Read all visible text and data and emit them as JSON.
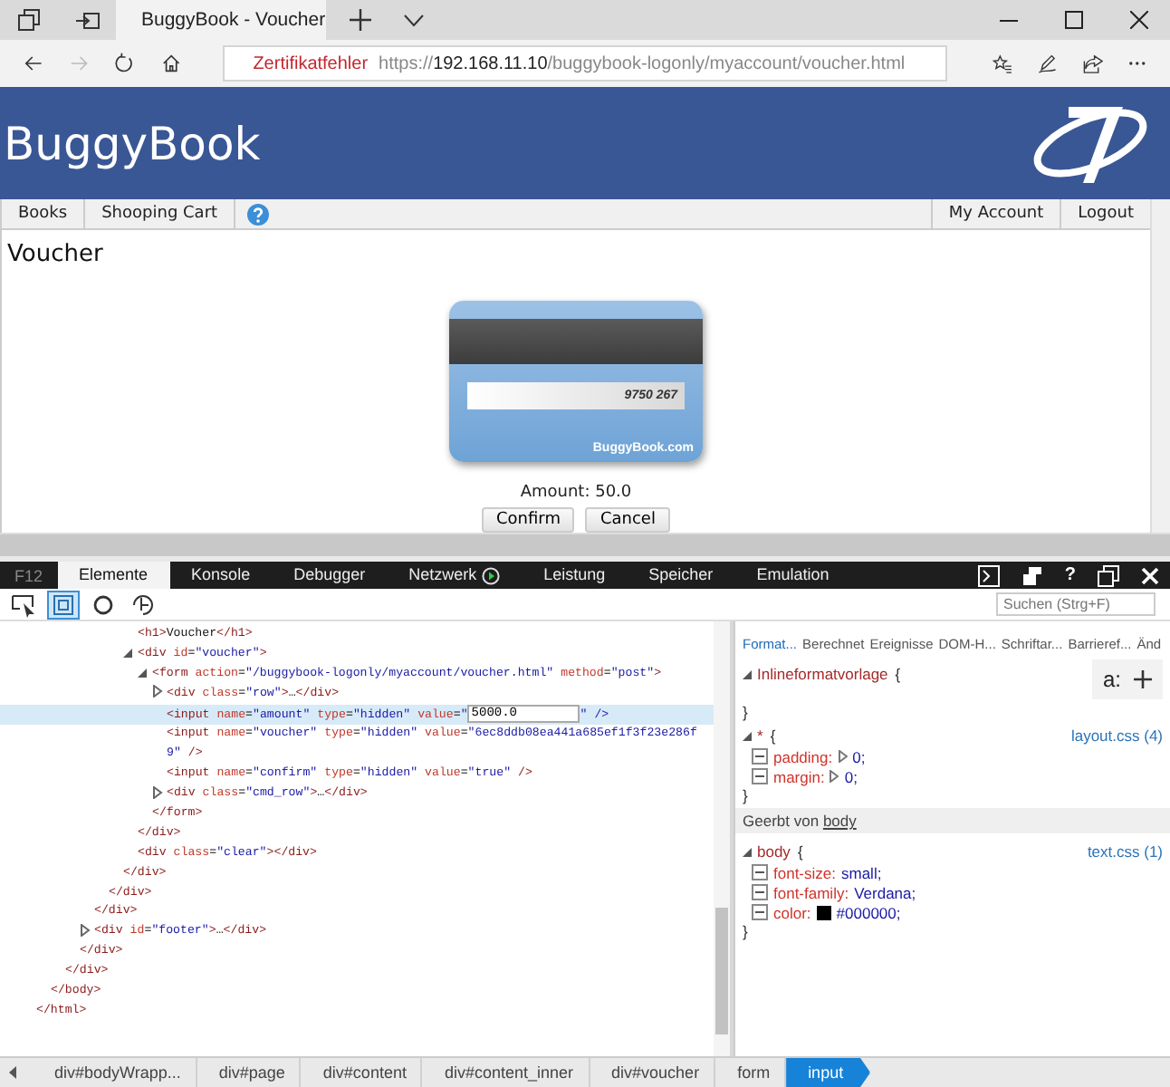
{
  "browser": {
    "tabs": [
      {
        "title": "BuggyBook - Voucher",
        "selected": true
      }
    ],
    "nav_buttons": [
      {
        "kind": "back",
        "disabled": false
      },
      {
        "kind": "forward",
        "disabled": true
      },
      {
        "kind": "refresh",
        "disabled": false
      },
      {
        "kind": "home",
        "disabled": false
      }
    ],
    "address": {
      "warning": "Zertifikatfehler",
      "scheme": "https://",
      "host": "192.168.11.10",
      "path": "/buggybook-logonly/myaccount/voucher.html"
    }
  },
  "site": {
    "title": "BuggyBook",
    "nav_left": [
      {
        "label": "Books"
      },
      {
        "label": "Shooping Cart"
      }
    ],
    "nav_right": [
      {
        "label": "My Account"
      },
      {
        "label": "Logout"
      }
    ],
    "heading": "Voucher",
    "card": {
      "strip_number": "9750 267",
      "brand": "BuggyBook.com"
    },
    "amount_label": "Amount:",
    "amount": "50.0",
    "buttons": [
      "Confirm",
      "Cancel"
    ]
  },
  "devtools": {
    "f12": "F12",
    "tabs": [
      {
        "label": "Elemente",
        "selected": true,
        "recording": false
      },
      {
        "label": "Konsole",
        "selected": false,
        "recording": false
      },
      {
        "label": "Debugger",
        "selected": false,
        "recording": false
      },
      {
        "label": "Netzwerk",
        "selected": false,
        "recording": true
      },
      {
        "label": "Leistung",
        "selected": false,
        "recording": false
      },
      {
        "label": "Speicher",
        "selected": false,
        "recording": false
      },
      {
        "label": "Emulation",
        "selected": false,
        "recording": false
      }
    ],
    "help": "?",
    "tools": [
      {
        "kind": "select",
        "selected": false
      },
      {
        "kind": "highlight",
        "selected": true
      },
      {
        "kind": "color",
        "selected": false
      },
      {
        "kind": "touch",
        "selected": false
      }
    ],
    "search": {
      "placeholder": "Suchen (Strg+F)"
    },
    "dom": [
      {
        "close": "</html>",
        "children": [
          {
            "close": "</body>",
            "children": [
              {
                "close": "</div>",
                "children": [
                  {
                    "close": "</div>",
                    "children": [
                      {
                        "close": "</div>",
                        "children": [
                          {
                            "close": "</div>",
                            "children": [
                              {
                                "close": "</div>",
                                "children": [
                                  {
                                    "line": "<h1>Voucher</h1>",
                                    "selected": false
                                  },
                                  {
                                    "line": "<div id=\"voucher\">",
                                    "selected": false,
                                    "expanded": true,
                                    "close": "</div>",
                                    "children": [
                                      {
                                        "line": "<form action=\"/buggybook-logonly/myaccount/voucher.html\" method=\"post\">",
                                        "selected": false,
                                        "expanded": true,
                                        "close": "</form>",
                                        "children": [
                                          {
                                            "line": "<div class=\"row\">…</div>",
                                            "selected": false,
                                            "expanded": false
                                          },
                                          {
                                            "line": "<input name=\"amount\" type=\"hidden\" value=\"",
                                            "edit": "5000.0",
                                            "line_end": "\" />",
                                            "selected": true
                                          },
                                          {
                                            "line": "<input name=\"voucher\" type=\"hidden\" value=\"6ec8ddb08ea441a685ef1f3f23e286f9\" />",
                                            "selected": false
                                          },
                                          {
                                            "line": "<input name=\"confirm\" type=\"hidden\" value=\"true\" />",
                                            "selected": false
                                          },
                                          {
                                            "line": "<div class=\"cmd_row\">…</div>",
                                            "selected": false,
                                            "expanded": false
                                          }
                                        ]
                                      }
                                    ]
                                  },
                                  {
                                    "line": "<div class=\"clear\"></div>",
                                    "selected": false
                                  }
                                ]
                              }
                            ]
                          }
                        ]
                      },
                      {
                        "line": "<div id=\"footer\">…</div>",
                        "selected": false,
                        "expanded": false
                      }
                    ]
                  }
                ]
              }
            ]
          }
        ]
      }
    ],
    "styles": {
      "tabs": [
        {
          "label": "Format...",
          "selected": true
        },
        {
          "label": "Berechnet",
          "selected": false
        },
        {
          "label": "Ereignisse",
          "selected": false
        },
        {
          "label": "DOM-H...",
          "selected": false
        },
        {
          "label": "Schriftar...",
          "selected": false
        },
        {
          "label": "Barrieref...",
          "selected": false
        },
        {
          "label": "Änd",
          "selected": false
        }
      ],
      "rules": [
        {
          "kind": "rule",
          "selector": "Inlineformatvorlage",
          "open": "{",
          "close": "}",
          "expanded": true,
          "action": "a:"
        },
        {
          "kind": "rule",
          "selector": "*",
          "open": "{",
          "close": "}",
          "expanded": true,
          "source": "layout.css (4)",
          "properties": [
            {
              "name": "padding:",
              "value": "0;",
              "checked": true,
              "expandable": true
            },
            {
              "name": "margin:",
              "value": "0;",
              "checked": true,
              "expandable": true
            }
          ]
        },
        {
          "kind": "inherited",
          "label": "Geerbt von",
          "link": "body"
        },
        {
          "kind": "rule",
          "selector": "body",
          "open": "{",
          "close": "}",
          "expanded": true,
          "source": "text.css (1)",
          "properties": [
            {
              "name": "font-size:",
              "value": "small;",
              "checked": true
            },
            {
              "name": "font-family:",
              "value": "Verdana;",
              "checked": true
            },
            {
              "name": "color:",
              "value": "#000000;",
              "color": "#000000",
              "checked": true
            }
          ]
        }
      ]
    },
    "breadcrumb": [
      {
        "label": "div#bodyWrapp...",
        "selected": false
      },
      {
        "label": "div#page",
        "selected": false
      },
      {
        "label": "div#content",
        "selected": false
      },
      {
        "label": "div#content_inner",
        "selected": false
      },
      {
        "label": "div#voucher",
        "selected": false
      },
      {
        "label": "form",
        "selected": false
      },
      {
        "label": "input",
        "selected": true
      }
    ]
  }
}
